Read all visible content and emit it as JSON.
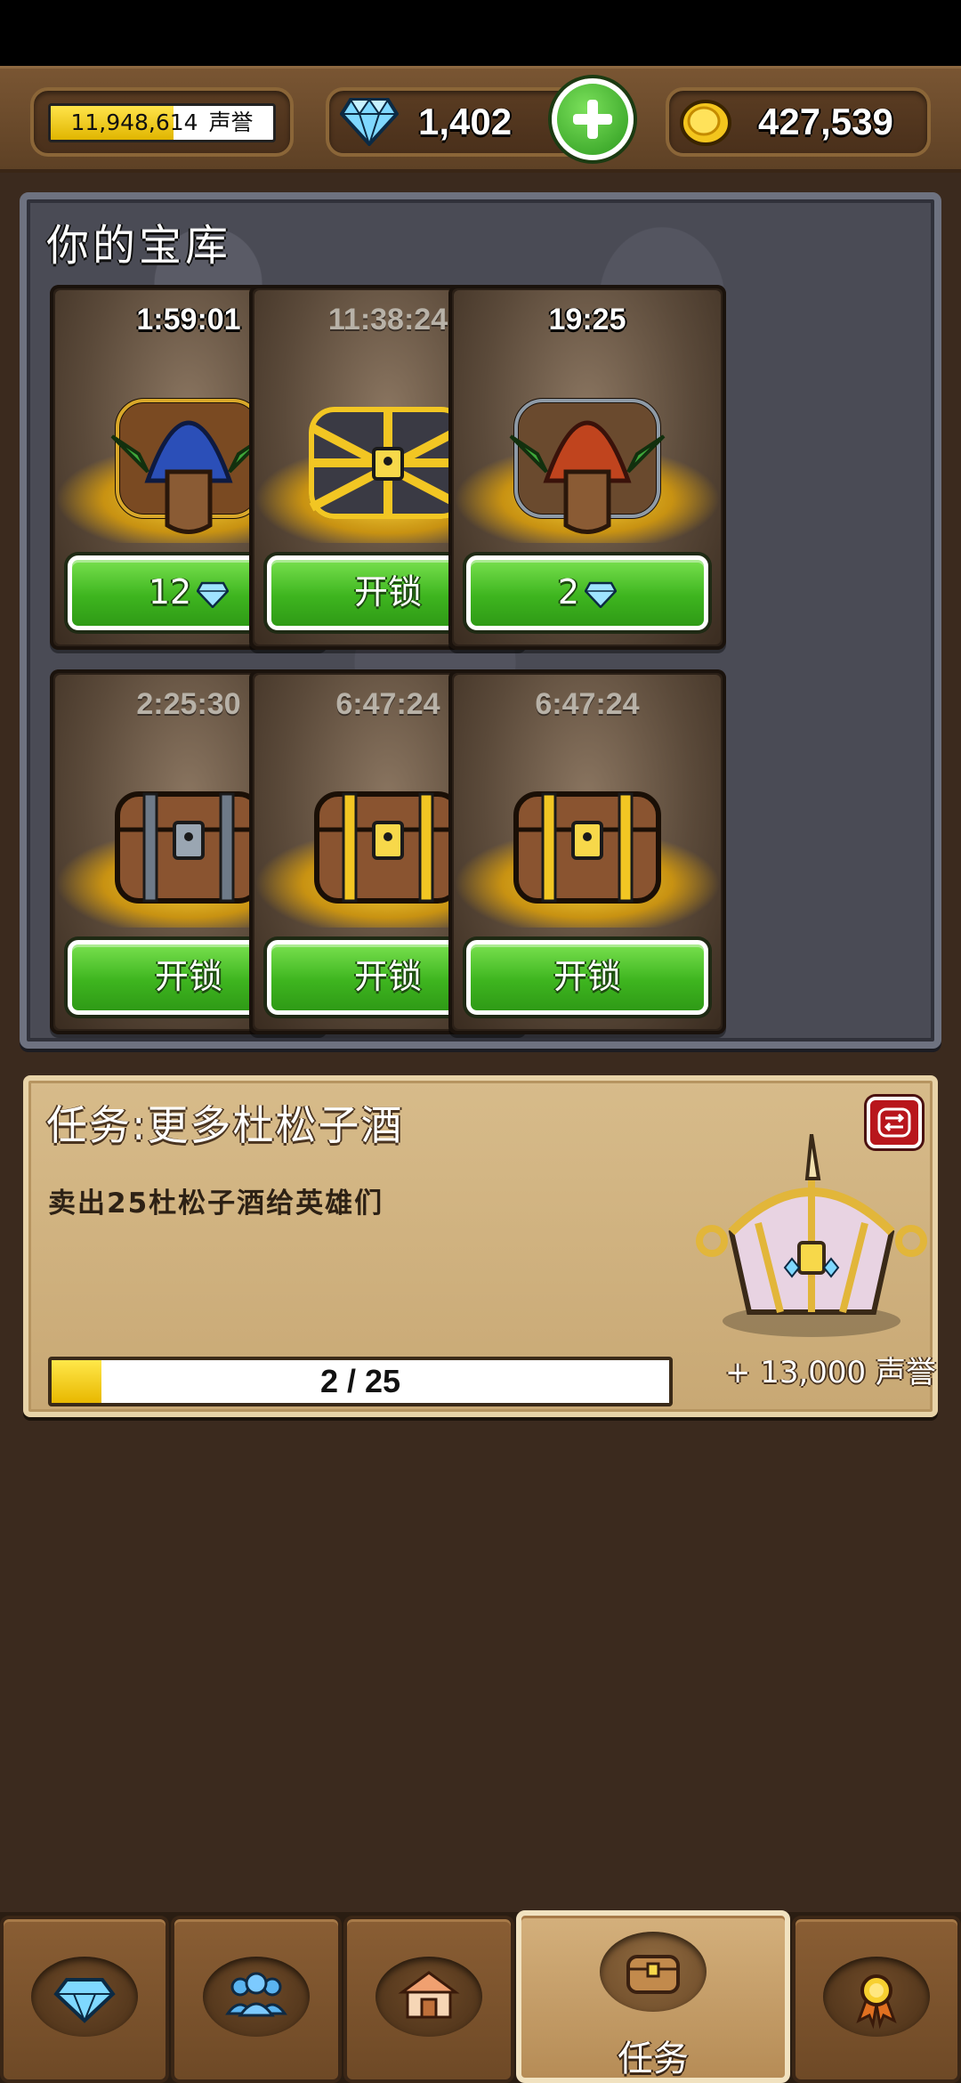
{
  "header": {
    "reputation_value": "11,948,614",
    "reputation_unit": "声誉",
    "reputation_fill": 0.55,
    "gems": "1,402",
    "gold": "427,539"
  },
  "vault": {
    "title": "你的宝库",
    "slots": [
      {
        "timer": "1:59:01",
        "button": "12",
        "button_icon": "diamond-icon",
        "chest": "goblin-chest-blue"
      },
      {
        "timer": "11:38:24",
        "button": "开锁",
        "chest": "golden-cage-chest"
      },
      {
        "timer": "19:25",
        "button": "2",
        "button_icon": "diamond-icon",
        "chest": "goblin-chest-red"
      },
      {
        "timer": "2:25:30",
        "button": "开锁",
        "chest": "iron-wooden-chest"
      },
      {
        "timer": "6:47:24",
        "button": "开锁",
        "chest": "golden-wooden-chest"
      },
      {
        "timer": "6:47:24",
        "button": "开锁",
        "chest": "golden-wooden-chest"
      }
    ]
  },
  "quest": {
    "title": "任务:更多杜松子酒",
    "description": "卖出25杜松子酒给英雄们",
    "progress_text": "2 / 25",
    "progress_value": 2,
    "progress_max": 25,
    "reward": "+ 13,000 声誉",
    "reward_icon": "unicorn-chest-icon"
  },
  "nav": {
    "tabs": [
      {
        "icon": "diamond-icon",
        "label": ""
      },
      {
        "icon": "heroes-icon",
        "label": ""
      },
      {
        "icon": "shop-icon",
        "label": ""
      },
      {
        "icon": "chest-icon",
        "label": "任务",
        "active": true
      },
      {
        "icon": "medal-icon",
        "label": ""
      }
    ]
  },
  "colors": {
    "button_green": "#3eb51f",
    "panel_stone": "#4a4b55",
    "parchment": "#c8a874",
    "progress_yellow": "#ffe84a"
  }
}
